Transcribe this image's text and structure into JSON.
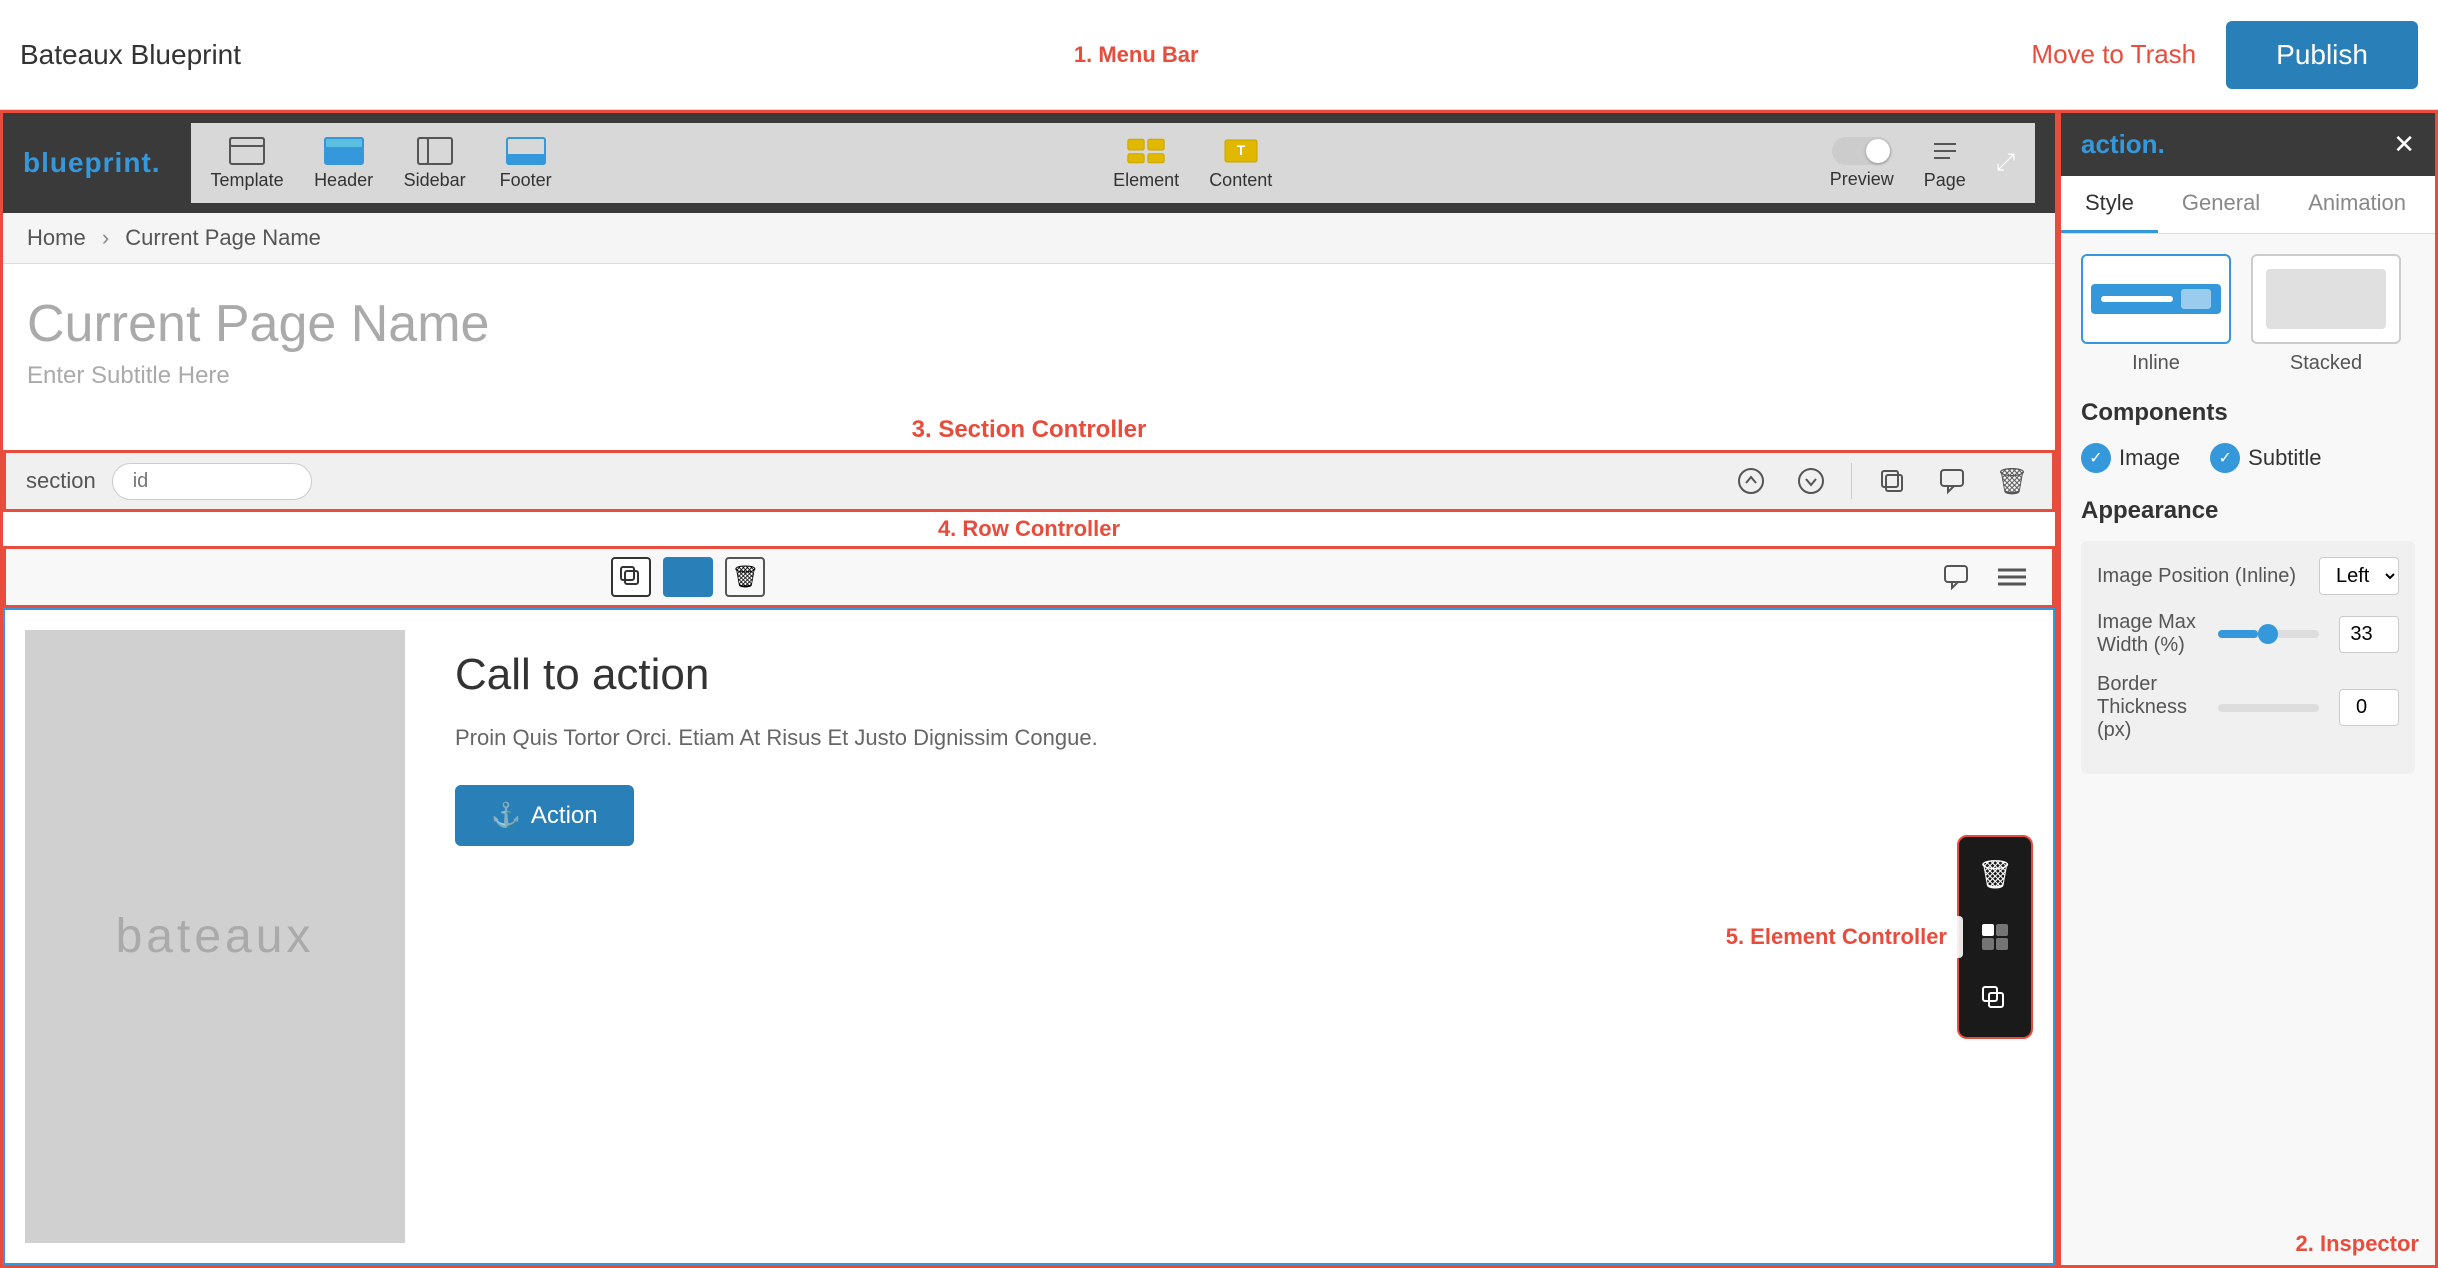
{
  "topBar": {
    "title": "Bateaux Blueprint",
    "menuLabel": "1. Menu Bar",
    "moveToTrash": "Move to Trash",
    "publishLabel": "Publish"
  },
  "toolbar": {
    "brand": "blueprint",
    "tools": [
      {
        "id": "template",
        "label": "Template"
      },
      {
        "id": "header",
        "label": "Header"
      },
      {
        "id": "sidebar",
        "label": "Sidebar"
      },
      {
        "id": "footer",
        "label": "Footer"
      }
    ],
    "rightTools": [
      {
        "id": "element",
        "label": "Element"
      },
      {
        "id": "content",
        "label": "Content"
      }
    ],
    "previewLabel": "Preview",
    "pageLabel": "Page"
  },
  "breadcrumb": {
    "home": "Home",
    "current": "Current Page Name"
  },
  "pageHeader": {
    "title": "Current Page Name",
    "subtitle": "Enter Subtitle Here"
  },
  "sectionController": {
    "label": "3. Section Controller",
    "tag": "section",
    "idPlaceholder": "id"
  },
  "rowController": {
    "label": "4. Row Controller"
  },
  "elementController": {
    "label": "5. Element Controller"
  },
  "contentArea": {
    "imagePlaceholder": "bateaux",
    "ctaTitle": "Call to action",
    "ctaBody": "Proin Quis Tortor Orci. Etiam At Risus Et Justo Dignissim Congue.",
    "ctaButtonLabel": "Action",
    "ctaButtonIcon": "⚓"
  },
  "inspector": {
    "title": "action",
    "titleDot": ".",
    "label": "2. Inspector",
    "tabs": [
      "Style",
      "General",
      "Animation"
    ],
    "activeTab": "Style",
    "styleOptions": [
      {
        "id": "inline",
        "label": "Inline"
      },
      {
        "id": "stacked",
        "label": "Stacked"
      }
    ],
    "componentsTitle": "Components",
    "components": [
      {
        "id": "image",
        "label": "Image",
        "checked": true
      },
      {
        "id": "subtitle",
        "label": "Subtitle",
        "checked": true
      }
    ],
    "appearanceTitle": "Appearance",
    "appearance": {
      "imagePositionLabel": "Image Position (Inline)",
      "imagePositionValue": "Left",
      "imageMaxWidthLabel": "Image Max Width (%)",
      "imageMaxWidthValue": "33",
      "borderThicknessLabel": "Border Thickness (px)",
      "borderThicknessValue": "0"
    }
  }
}
